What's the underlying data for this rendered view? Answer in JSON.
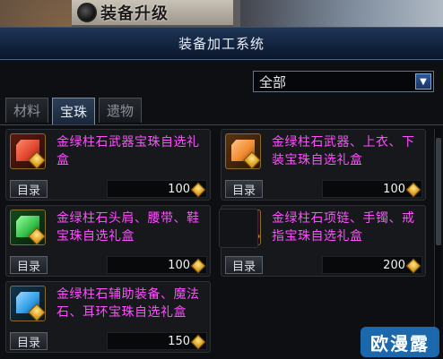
{
  "banner": {
    "title": "装备升级"
  },
  "window": {
    "title": "装备加工系统"
  },
  "filter": {
    "selected": "全部"
  },
  "tabs": [
    {
      "label": "材料",
      "active": false
    },
    {
      "label": "宝珠",
      "active": true
    },
    {
      "label": "遗物",
      "active": false
    }
  ],
  "items": [
    {
      "name": "金绿柱石武器宝珠自选礼盒",
      "button": "目录",
      "price": "100",
      "icon": "red-gem-box-icon",
      "gem_color": "#e0452e"
    },
    {
      "name": "金绿柱石武器、上衣、下装宝珠自选礼盒",
      "button": "目录",
      "price": "100",
      "icon": "orange-gem-box-icon",
      "gem_color": "#f08a2c"
    },
    {
      "name": "金绿柱石头肩、腰带、鞋宝珠自选礼盒",
      "button": "目录",
      "price": "100",
      "icon": "green-gem-box-icon",
      "gem_color": "#35c04b"
    },
    {
      "name": "金绿柱石项链、手镯、戒指宝珠自选礼盒",
      "button": "目录",
      "price": "200",
      "icon": "pink-gem-box-icon",
      "gem_color": "#e446c9"
    },
    {
      "name": "金绿柱石辅助装备、魔法石、耳环宝珠自选礼盒",
      "button": "目录",
      "price": "150",
      "icon": "blue-gem-box-icon",
      "gem_color": "#2f9ee8"
    }
  ],
  "watermark": "欧漫露"
}
